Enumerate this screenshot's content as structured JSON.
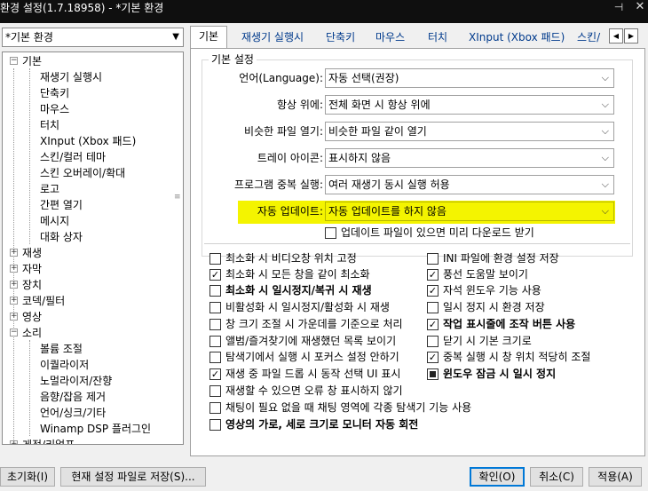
{
  "window": {
    "title": "환경 설정(1.7.18958) - *기본 환경",
    "pin_glyph": "⊣",
    "close_glyph": "✕"
  },
  "profile": {
    "selected": "*기본 환경"
  },
  "tree": {
    "items": [
      {
        "label": "기본",
        "expanded": true
      },
      {
        "label": "재생기 실행시"
      },
      {
        "label": "단축키"
      },
      {
        "label": "마우스"
      },
      {
        "label": "터치"
      },
      {
        "label": "XInput (Xbox 패드)"
      },
      {
        "label": "스킨/컬러 테마"
      },
      {
        "label": "스킨 오버레이/확대"
      },
      {
        "label": "로고"
      },
      {
        "label": "간편 열기"
      },
      {
        "label": "메시지"
      },
      {
        "label": "대화 상자"
      },
      {
        "label": "재생",
        "expanded": false
      },
      {
        "label": "자막",
        "expanded": false
      },
      {
        "label": "장치",
        "expanded": false
      },
      {
        "label": "코덱/필터",
        "expanded": false
      },
      {
        "label": "영상",
        "expanded": false
      },
      {
        "label": "소리",
        "expanded": true
      },
      {
        "label": "볼륨 조절"
      },
      {
        "label": "이퀄라이저"
      },
      {
        "label": "노멀라이저/잔향"
      },
      {
        "label": "음향/잡음 제거"
      },
      {
        "label": "언어/싱크/기타"
      },
      {
        "label": "Winamp DSP 플러그인"
      },
      {
        "label": "게정/리얼프"
      }
    ]
  },
  "tabs": [
    {
      "label": "기본",
      "active": true
    },
    {
      "label": "재생기 실행시"
    },
    {
      "label": "단축키"
    },
    {
      "label": "마우스"
    },
    {
      "label": "터치"
    },
    {
      "label": "XInput (Xbox 패드)"
    },
    {
      "label": "스킨/"
    }
  ],
  "tab_scroll": {
    "left": "◀",
    "right": "▶"
  },
  "basic": {
    "group_title": "기본 설정",
    "rows": [
      {
        "label": "언어(Language):",
        "value": "자동 선택(권장)"
      },
      {
        "label": "항상 위에:",
        "value": "전체 화면 시 항상 위에"
      },
      {
        "label": "비슷한 파일 열기:",
        "value": "비슷한 파일 같이 열기"
      },
      {
        "label": "트레이 아이콘:",
        "value": "표시하지 않음"
      },
      {
        "label": "프로그램 중복 실행:",
        "value": "여러 재생기 동시 실행 허용"
      },
      {
        "label": "자동 업데이트:",
        "value": "자동 업데이트를 하지 않음"
      }
    ],
    "update_download": {
      "label": "업데이트 파일이 있으면 미리 다운로드 받기",
      "checked": false
    }
  },
  "options_left": [
    {
      "label": "최소화 시 비디오창 위치 고정",
      "state": "off"
    },
    {
      "label": "최소화 시 모든 창을 같이 최소화",
      "state": "on"
    },
    {
      "label": "최소화 시 일시정지/복귀 시 재생",
      "state": "off",
      "bold": true
    },
    {
      "label": "비활성화 시 일시정지/활성화 시 재생",
      "state": "off"
    },
    {
      "label": "창 크기 조절 시 가운데를 기준으로 처리",
      "state": "off"
    },
    {
      "label": "앨범/즐겨찾기에 재생했던 목록 보이기",
      "state": "off"
    },
    {
      "label": "탐색기에서 실행 시 포커스 설정 안하기",
      "state": "off"
    },
    {
      "label": "재생 중 파일 드롭 시 동작 선택 UI 표시",
      "state": "on"
    },
    {
      "label": "재생할 수 있으면 오류 창 표시하지 않기",
      "state": "off"
    },
    {
      "label": "채팅이 필요 없을 때 채팅 영역에 각종 탐색기 기능 사용",
      "state": "off"
    },
    {
      "label": "영상의 가로, 세로 크기로 모니터 자동 회전",
      "state": "off",
      "bold": true
    }
  ],
  "options_right": [
    {
      "label": "INI 파일에 환경 설정 저장",
      "state": "off"
    },
    {
      "label": "풍선 도움말 보이기",
      "state": "on"
    },
    {
      "label": "자석 윈도우 기능 사용",
      "state": "on"
    },
    {
      "label": "일시 정지 시 환경 저장",
      "state": "off"
    },
    {
      "label": "작업 표시줄에 조작 버튼 사용",
      "state": "on",
      "bold": true
    },
    {
      "label": "닫기 시 기본 크기로",
      "state": "off"
    },
    {
      "label": "중복 실행 시 창 위치 적당히 조절",
      "state": "on"
    },
    {
      "label": "윈도우 잠금 시 일시 정지",
      "state": "indeterminate",
      "bold": true
    }
  ],
  "buttons": {
    "reset": "초기화(I)",
    "save_current": "현재 설정 파일로 저장(S)...",
    "ok": "확인(O)",
    "cancel": "취소(C)",
    "apply": "적용(A)"
  },
  "colors": {
    "highlight": "#f4f400",
    "title_bg": "#0f0f0f",
    "tab_text": "#003a8c"
  }
}
